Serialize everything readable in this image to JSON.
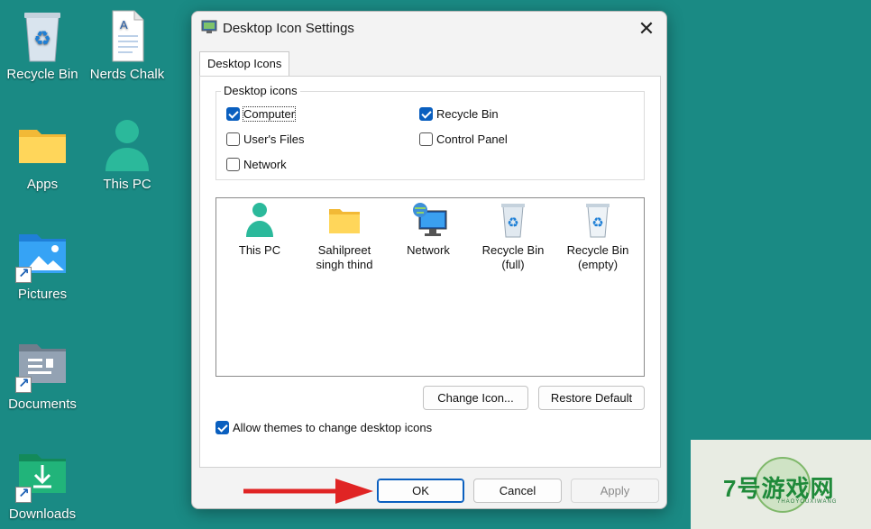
{
  "desktop": {
    "icons": [
      {
        "label": "Recycle Bin"
      },
      {
        "label": "Nerds Chalk"
      },
      {
        "label": "Apps"
      },
      {
        "label": "This PC"
      },
      {
        "label": "Pictures"
      },
      {
        "label": "Documents"
      },
      {
        "label": "Downloads"
      }
    ]
  },
  "dialog": {
    "title": "Desktop Icon Settings",
    "close_label": "✕",
    "tab": "Desktop Icons",
    "group_label": "Desktop icons",
    "checkboxes": [
      {
        "label": "Computer",
        "checked": true
      },
      {
        "label": "Recycle Bin",
        "checked": true
      },
      {
        "label": "User's Files",
        "checked": false
      },
      {
        "label": "Control Panel",
        "checked": false
      },
      {
        "label": "Network",
        "checked": false
      }
    ],
    "icon_list": [
      {
        "line1": "This PC",
        "line2": ""
      },
      {
        "line1": "Sahilpreet",
        "line2": "singh thind"
      },
      {
        "line1": "Network",
        "line2": ""
      },
      {
        "line1": "Recycle Bin",
        "line2": "(full)"
      },
      {
        "line1": "Recycle Bin",
        "line2": "(empty)"
      }
    ],
    "change_icon_label": "Change Icon...",
    "restore_default_label": "Restore Default",
    "allow_themes_label": "Allow themes to change desktop icons",
    "allow_themes_checked": true,
    "ok_label": "OK",
    "cancel_label": "Cancel",
    "apply_label": "Apply"
  },
  "watermark": {
    "text": "7号游戏网",
    "sub": "7HAOYOUXIWANG"
  },
  "colors": {
    "desktop": "#1a8a84",
    "accent": "#0a5fbf",
    "arrow": "#e02424"
  }
}
